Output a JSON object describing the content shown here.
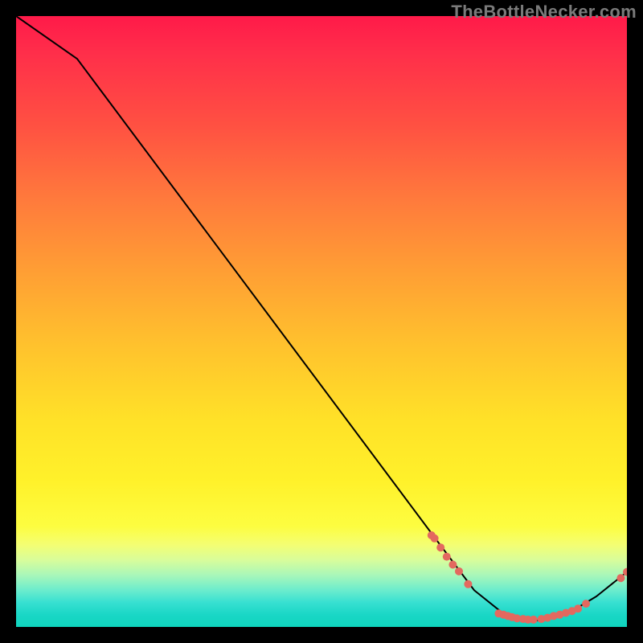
{
  "watermark": "TheBottleNecker.com",
  "chart_data": {
    "type": "line",
    "title": "",
    "xlabel": "",
    "ylabel": "",
    "xlim": [
      0,
      100
    ],
    "ylim": [
      0,
      100
    ],
    "series": [
      {
        "name": "curve",
        "points": [
          [
            0,
            100
          ],
          [
            10,
            93
          ],
          [
            69,
            14
          ],
          [
            75,
            6
          ],
          [
            80,
            2
          ],
          [
            85,
            1
          ],
          [
            90,
            2
          ],
          [
            95,
            5
          ],
          [
            100,
            9
          ]
        ]
      }
    ],
    "markers": [
      {
        "x": 68.0,
        "y": 15.0
      },
      {
        "x": 68.5,
        "y": 14.5
      },
      {
        "x": 69.5,
        "y": 13.0
      },
      {
        "x": 70.5,
        "y": 11.5
      },
      {
        "x": 71.5,
        "y": 10.2
      },
      {
        "x": 72.5,
        "y": 9.1
      },
      {
        "x": 74.0,
        "y": 7.0
      },
      {
        "x": 79.0,
        "y": 2.2
      },
      {
        "x": 79.8,
        "y": 2.0
      },
      {
        "x": 80.5,
        "y": 1.8
      },
      {
        "x": 81.2,
        "y": 1.6
      },
      {
        "x": 82.0,
        "y": 1.4
      },
      {
        "x": 83.0,
        "y": 1.3
      },
      {
        "x": 83.8,
        "y": 1.2
      },
      {
        "x": 84.7,
        "y": 1.2
      },
      {
        "x": 86.0,
        "y": 1.3
      },
      {
        "x": 87.0,
        "y": 1.5
      },
      {
        "x": 88.0,
        "y": 1.8
      },
      {
        "x": 89.0,
        "y": 2.0
      },
      {
        "x": 90.0,
        "y": 2.3
      },
      {
        "x": 91.0,
        "y": 2.6
      },
      {
        "x": 92.0,
        "y": 3.0
      },
      {
        "x": 93.3,
        "y": 3.8
      },
      {
        "x": 99.0,
        "y": 8.0
      },
      {
        "x": 100.0,
        "y": 9.0
      }
    ],
    "marker_color": "#e3695f",
    "line_color": "#000000",
    "grid": false,
    "legend": false
  }
}
